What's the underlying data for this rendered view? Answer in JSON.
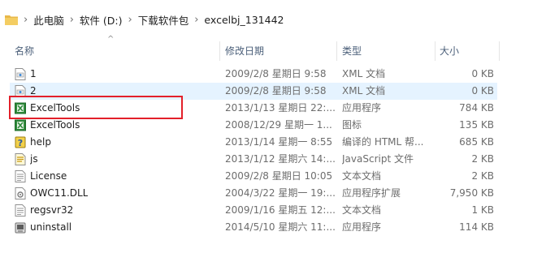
{
  "breadcrumb": [
    "此电脑",
    "软件 (D:)",
    "下载软件包",
    "excelbj_131442"
  ],
  "columns": {
    "name": "名称",
    "date": "修改日期",
    "type": "类型",
    "size": "大小"
  },
  "files": [
    {
      "name": "1",
      "date": "2009/2/8 星期日 9:58",
      "type": "XML 文档",
      "size": "0 KB",
      "icon": "xml-file-icon"
    },
    {
      "name": "2",
      "date": "2009/2/8 星期日 9:58",
      "type": "XML 文档",
      "size": "0 KB",
      "icon": "xml-file-icon"
    },
    {
      "name": "ExcelTools",
      "date": "2013/1/13 星期日 22:...",
      "type": "应用程序",
      "size": "784 KB",
      "icon": "excel-app-icon"
    },
    {
      "name": "ExcelTools",
      "date": "2008/12/29 星期一 1...",
      "type": "图标",
      "size": "135 KB",
      "icon": "excel-app-icon"
    },
    {
      "name": "help",
      "date": "2013/1/14 星期一 8:55",
      "type": "编译的 HTML 帮...",
      "size": "685 KB",
      "icon": "help-file-icon"
    },
    {
      "name": "js",
      "date": "2013/1/12 星期六 14:...",
      "type": "JavaScript 文件",
      "size": "2 KB",
      "icon": "script-file-icon"
    },
    {
      "name": "License",
      "date": "2009/2/8 星期日 10:05",
      "type": "文本文档",
      "size": "2 KB",
      "icon": "text-file-icon"
    },
    {
      "name": "OWC11.DLL",
      "date": "2004/3/22 星期一 19:...",
      "type": "应用程序扩展",
      "size": "7,950 KB",
      "icon": "dll-file-icon"
    },
    {
      "name": "regsvr32",
      "date": "2009/1/16 星期五 12:...",
      "type": "文本文档",
      "size": "1 KB",
      "icon": "text-file-icon"
    },
    {
      "name": "uninstall",
      "date": "2014/5/10 星期六 11:...",
      "type": "应用程序",
      "size": "114 KB",
      "icon": "uninstall-app-icon"
    }
  ],
  "hovered_row": 1,
  "highlighted_row": 2,
  "colors": {
    "highlight_border": "#e3202a",
    "hover_bg": "#e5f3ff",
    "header_text": "#4c607a"
  }
}
